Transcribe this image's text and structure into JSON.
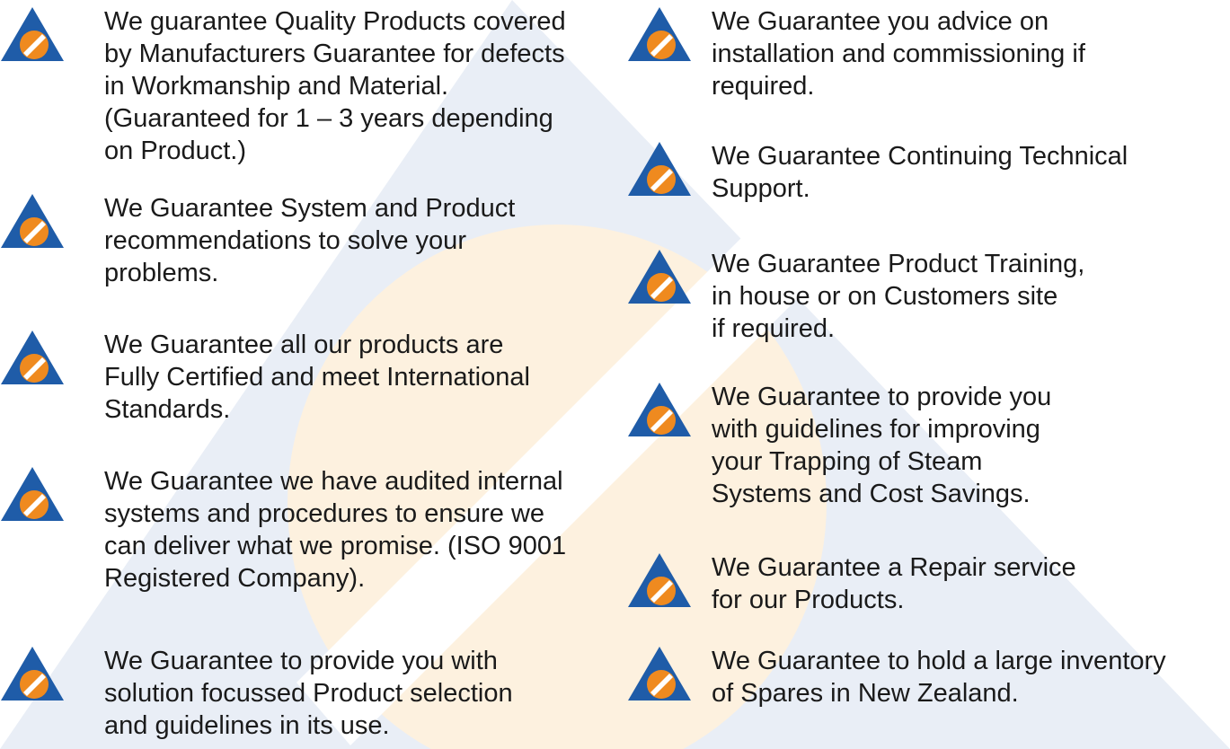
{
  "colors": {
    "logo_blue": "#1f5ca8",
    "logo_orange": "#ef8a1f",
    "watermark_blue": "#e9eef6",
    "watermark_orange": "#fdf1df",
    "text": "#1a1a1a"
  },
  "left_items": [
    {
      "text": "We guarantee Quality Products covered\nby Manufacturers Guarantee for defects\nin Workmanship and Material.\n(Guaranteed for 1 – 3 years depending\non Product.)"
    },
    {
      "text": "We Guarantee System and Product\nrecommendations to solve your\nproblems."
    },
    {
      "text": "We Guarantee all our products are\nFully Certified and meet International\nStandards."
    },
    {
      "text": "We Guarantee we have audited internal\nsystems and procedures to ensure we\ncan deliver what we promise. (ISO 9001\nRegistered Company)."
    },
    {
      "text": "We Guarantee to provide you with\nsolution focussed Product selection\nand guidelines in its use."
    }
  ],
  "right_items": [
    {
      "text": "We Guarantee you advice on\ninstallation and commissioning if\nrequired."
    },
    {
      "text": "We Guarantee Continuing Technical\nSupport."
    },
    {
      "text": "We Guarantee Product Training,\nin house or on Customers site\nif required."
    },
    {
      "text": "We Guarantee to provide you\nwith guidelines for improving\nyour Trapping of Steam\nSystems and Cost Savings."
    },
    {
      "text": "We Guarantee a Repair service\nfor our Products."
    },
    {
      "text": "We Guarantee to hold a large inventory\nof Spares in New Zealand."
    }
  ]
}
